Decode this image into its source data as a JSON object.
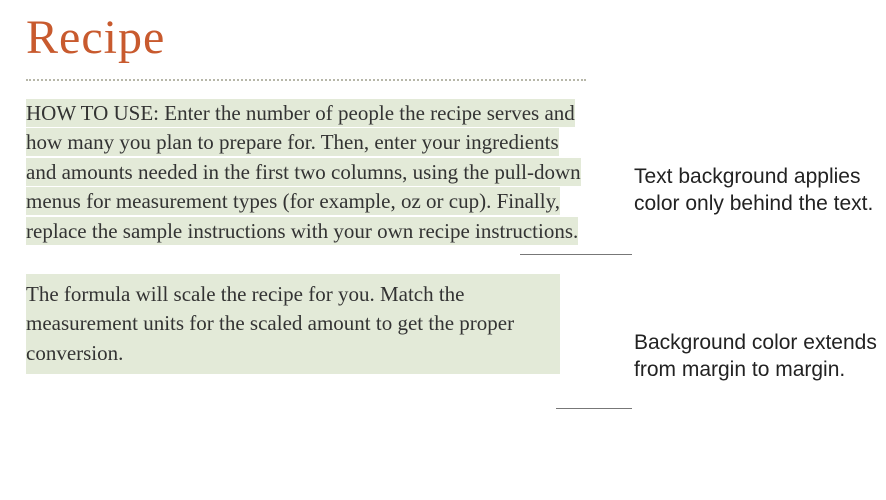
{
  "title": "Recipe",
  "paragraph1": "HOW TO USE: Enter the number of people the recipe serves and how many you plan to prepare for. Then, enter your ingredients and amounts needed in the first two columns, using the pull-down menus for measurement types (for example, oz or cup). Finally, replace the sample instructions with your own recipe instructions.",
  "paragraph2": "The formula will scale the recipe for you. Match the measurement units for the scaled amount to get the proper conversion.",
  "callouts": {
    "text_bg": "Text background applies color only behind the text.",
    "para_bg": "Background color extends from margin to margin."
  },
  "colors": {
    "title": "#c85a2e",
    "highlight": "#e3ead8"
  }
}
